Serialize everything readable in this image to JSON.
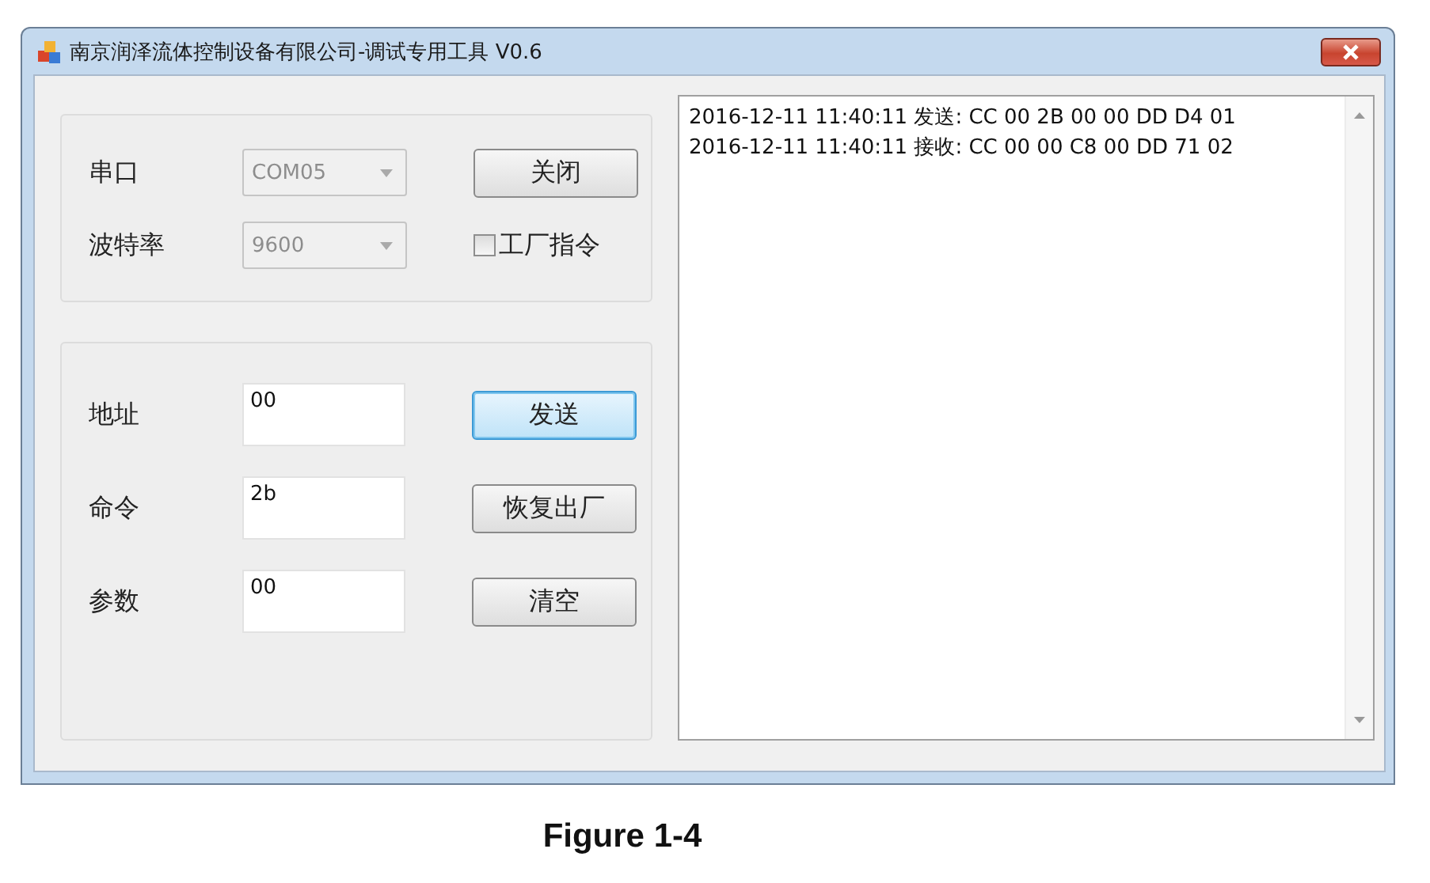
{
  "window": {
    "title": "南京润泽流体控制设备有限公司-调试专用工具 V0.6"
  },
  "port_group": {
    "fields": [
      {
        "label": "串口",
        "value": "COM05",
        "disabled": true
      },
      {
        "label": "波特率",
        "value": "9600",
        "disabled": true
      }
    ],
    "button": "关闭",
    "checkbox": {
      "label": "工厂指令",
      "checked": false
    }
  },
  "command_group": {
    "fields": [
      {
        "label": "地址",
        "value": "00"
      },
      {
        "label": "命令",
        "value": "2b"
      },
      {
        "label": "参数",
        "value": "00"
      }
    ],
    "buttons": [
      {
        "label": "发送",
        "focused": true
      },
      {
        "label": "恢复出厂",
        "focused": false
      },
      {
        "label": "清空",
        "focused": false
      }
    ]
  },
  "log": [
    "2016-12-11 11:40:11 发送: CC 00 2B 00 00 DD D4 01",
    "2016-12-11 11:40:11 接收: CC 00 00 C8 00 DD 71 02"
  ],
  "caption": "Figure 1-4"
}
